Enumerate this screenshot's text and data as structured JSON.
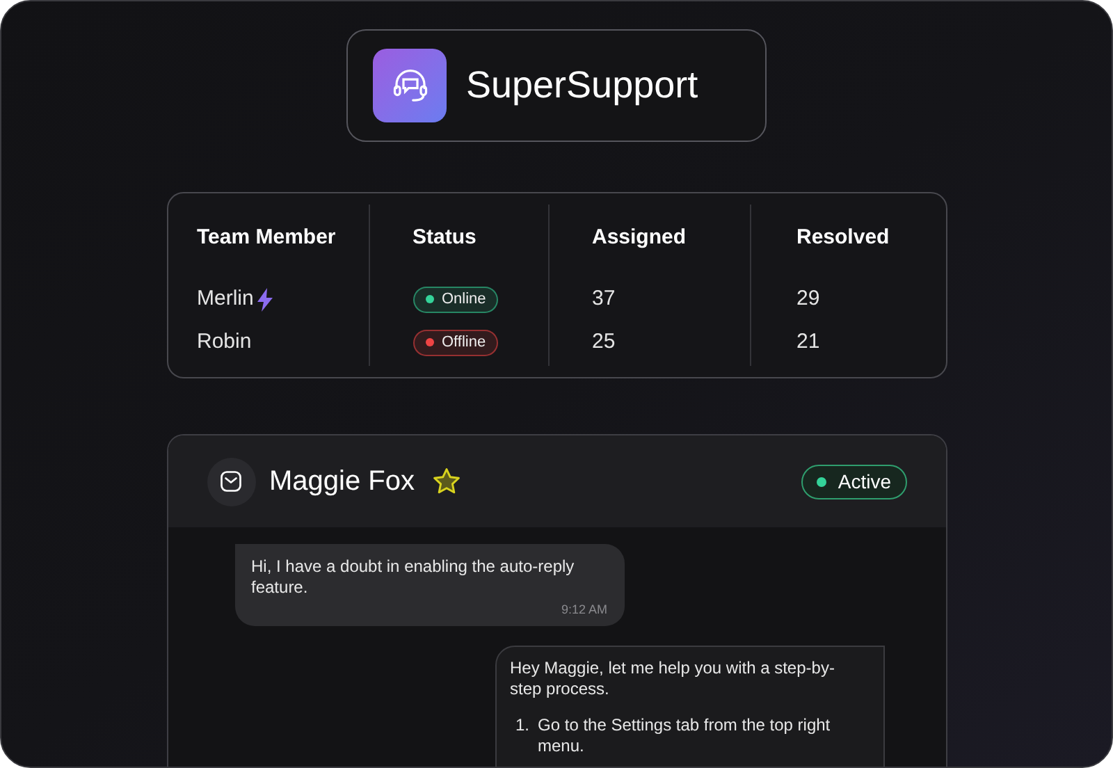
{
  "brand": {
    "name": "SuperSupport"
  },
  "team_table": {
    "columns": [
      "Team Member",
      "Status",
      "Assigned",
      "Resolved"
    ],
    "rows": [
      {
        "member": "Merlin",
        "featured": true,
        "status": "Online",
        "color": "#34d399",
        "assigned": "37",
        "resolved": "29"
      },
      {
        "member": "Robin",
        "featured": false,
        "status": "Offline",
        "color": "#ef4444",
        "assigned": "25",
        "resolved": "21"
      }
    ]
  },
  "chat": {
    "contact": "Maggie Fox",
    "starred": true,
    "status": "Active",
    "messages": [
      {
        "kind": "incoming",
        "text": "Hi, I have a doubt in enabling the auto-reply feature.",
        "time": "9:12 AM"
      },
      {
        "kind": "outgoing",
        "text": "Hey Maggie, let me help you with a step-by-step process.",
        "steps": [
          {
            "number": "1.",
            "text": "Go to the Settings tab from the top right menu."
          }
        ]
      }
    ]
  }
}
